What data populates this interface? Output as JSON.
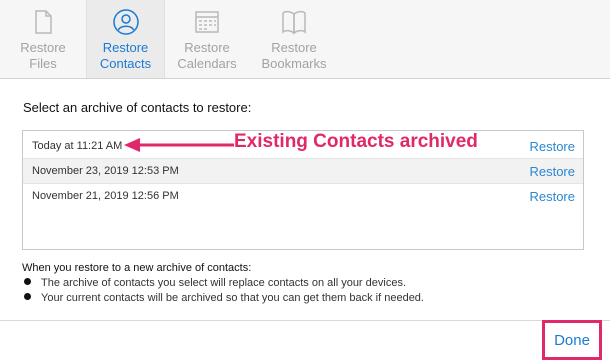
{
  "toolbar": {
    "tabs": [
      {
        "line1": "Restore",
        "line2": "Files",
        "icon": "document-icon"
      },
      {
        "line1": "Restore",
        "line2": "Contacts",
        "icon": "contact-icon"
      },
      {
        "line1": "Restore",
        "line2": "Calendars",
        "icon": "calendar-icon"
      },
      {
        "line1": "Restore",
        "line2": "Bookmarks",
        "icon": "book-icon"
      }
    ],
    "active_tab": 1
  },
  "main": {
    "heading": "Select an archive of contacts to restore:",
    "archives": [
      {
        "date": "Today at 11:21 AM",
        "action": "Restore"
      },
      {
        "date": "November 23, 2019 12:53 PM",
        "action": "Restore"
      },
      {
        "date": "November 21, 2019 12:56 PM",
        "action": "Restore"
      }
    ],
    "annotation": "Existing Contacts archived"
  },
  "notes": {
    "title": "When you restore to a new archive of contacts:",
    "bullets": [
      "The archive of contacts you select will replace contacts on all your devices.",
      "Your current contacts will be archived so that you can get them back if needed."
    ]
  },
  "footer": {
    "done_label": "Done"
  },
  "colors": {
    "accent": "#1b7ad3",
    "link": "#2b86d2",
    "highlight": "#e0286a"
  }
}
